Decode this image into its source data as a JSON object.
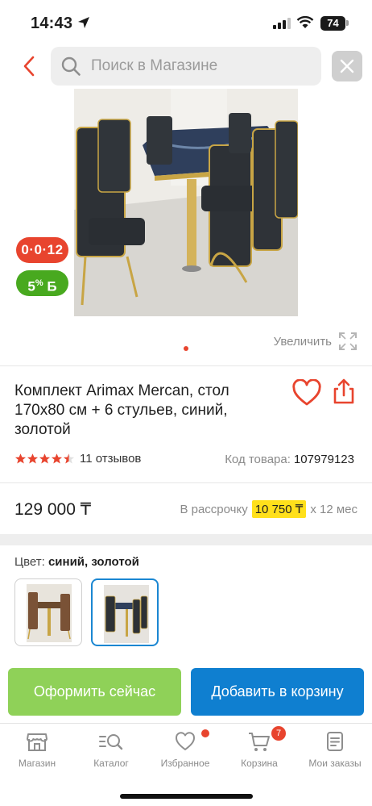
{
  "status_bar": {
    "time": "14:43",
    "battery": "74"
  },
  "search": {
    "placeholder": "Поиск в Магазине"
  },
  "badges": {
    "installment": "0·0·12",
    "bonus_percent": "5",
    "bonus_percent_sign": "%",
    "bonus_currency": "Б"
  },
  "gallery": {
    "zoom_label": "Увеличить",
    "current_page": 1,
    "page_count": 1
  },
  "product": {
    "title": "Комплект Arimax Mercan, стол 170x80 см + 6 стульев, синий, золотой",
    "rating_stars": 4.5,
    "reviews": "11 отзывов",
    "sku_label": "Код товара:",
    "sku": "107979123",
    "price": "129 000 ₸",
    "installment_prefix": "В рассрочку",
    "installment_amount": "10 750 ₸",
    "installment_suffix": "x 12 мес"
  },
  "color": {
    "label": "Цвет:",
    "value": "синий, золотой",
    "selected_index": 1
  },
  "actions": {
    "buy_now": "Оформить сейчас",
    "add_to_cart": "Добавить в корзину"
  },
  "tabbar": {
    "items": [
      {
        "label": "Магазин",
        "icon": "store-icon"
      },
      {
        "label": "Каталог",
        "icon": "catalog-search-icon"
      },
      {
        "label": "Избранное",
        "icon": "heart-icon"
      },
      {
        "label": "Корзина",
        "icon": "cart-icon"
      },
      {
        "label": "Мои заказы",
        "icon": "orders-icon"
      }
    ],
    "cart_count": "7"
  },
  "colors": {
    "accent_red": "#e8442e",
    "bonus_green": "#48a91f",
    "buy_green": "#8fd158",
    "cart_blue": "#0f7fd0",
    "installment_yellow": "#ffe01b"
  }
}
